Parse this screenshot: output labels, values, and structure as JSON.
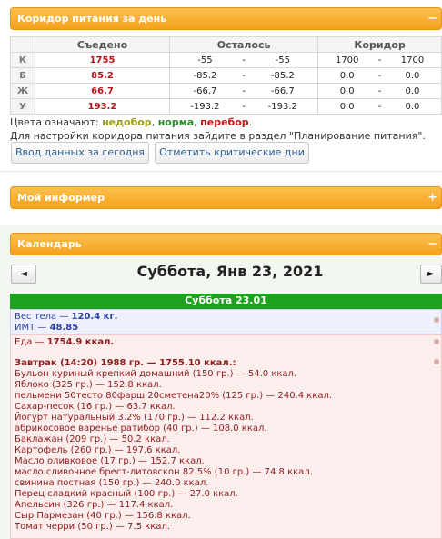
{
  "corridor_panel": {
    "title": "Коридор питания за день",
    "collapse_icon": "−",
    "headers": [
      "",
      "Съедено",
      "Осталось",
      "Коридор"
    ],
    "rows": [
      {
        "label": "К",
        "eaten": "1755",
        "left_a": "-55",
        "left_sep": "-",
        "left_b": "-55",
        "cor_a": "1700",
        "cor_sep": "-",
        "cor_b": "1700"
      },
      {
        "label": "Б",
        "eaten": "85.2",
        "left_a": "-85.2",
        "left_sep": "-",
        "left_b": "-85.2",
        "cor_a": "0.0",
        "cor_sep": "-",
        "cor_b": "0.0"
      },
      {
        "label": "Ж",
        "eaten": "66.7",
        "left_a": "-66.7",
        "left_sep": "-",
        "left_b": "-66.7",
        "cor_a": "0.0",
        "cor_sep": "-",
        "cor_b": "0.0"
      },
      {
        "label": "У",
        "eaten": "193.2",
        "left_a": "-193.2",
        "left_sep": "-",
        "left_b": "-193.2",
        "cor_a": "0.0",
        "cor_sep": "-",
        "cor_b": "0.0"
      }
    ],
    "legend_prefix": "Цвета означают: ",
    "legend_under": "недобор",
    "legend_comma1": ", ",
    "legend_norm": "норма",
    "legend_comma2": ", ",
    "legend_over": "перебор",
    "legend_end": ".",
    "hint": "Для настройки коридора питания зайдите в раздел \"Планирование питания\".",
    "btn_enter": "Ввод данных за сегодня",
    "btn_critical": "Отметить критические дни"
  },
  "informer_panel": {
    "title": "Мой информер",
    "expand_icon": "+"
  },
  "calendar_panel": {
    "title": "Календарь",
    "collapse_icon": "−",
    "prev": "◄",
    "next": "►",
    "date_title": "Суббота, Янв 23, 2021",
    "day_bar": "Суббота 23.01",
    "weight_label": "Вес тела — ",
    "weight_value": "120.4 кг.",
    "bmi_label": "ИМТ — ",
    "bmi_value": "48.85",
    "food_label": "Еда — ",
    "food_value": "1754.9 ккал.",
    "breakfast": "Завтрак (14:20) 1988 гр. — 1755.10 ккал.:",
    "items": [
      "Бульон куриный крепкий домашний (150 гр.) — 54.0 ккал.",
      "Яблоко (325 гр.) — 152.8 ккал.",
      "пельмени 50тесто 80фарш 20сметена20% (125 гр.) — 240.4 ккал.",
      "Сахар-песок (16 гр.) — 63.7 ккал.",
      "Йогурт натуральный 3.2% (170 гр.) — 112.2 ккал.",
      "абрикосовое варенье ратибор (40 гр.) — 108.0 ккал.",
      "Баклажан (209 гр.) — 50.2 ккал.",
      "Картофель (260 гр.) — 197.6 ккал.",
      "Масло оливковое (17 гр.) — 152.7 ккал.",
      "масло сливочное брест-литовскон 82.5% (10 гр.) — 74.8 ккал.",
      "свинина постная (150 гр.) — 240.0 ккал.",
      "Перец сладкий красный (100 гр.) — 27.0 ккал.",
      "Апельсин (326 гр.) — 117.4 ккал.",
      "Сыр Пармезан (40 гр.) — 156.8 ккал.",
      "Томат черри (50 гр.) — 7.5 ккал."
    ]
  }
}
